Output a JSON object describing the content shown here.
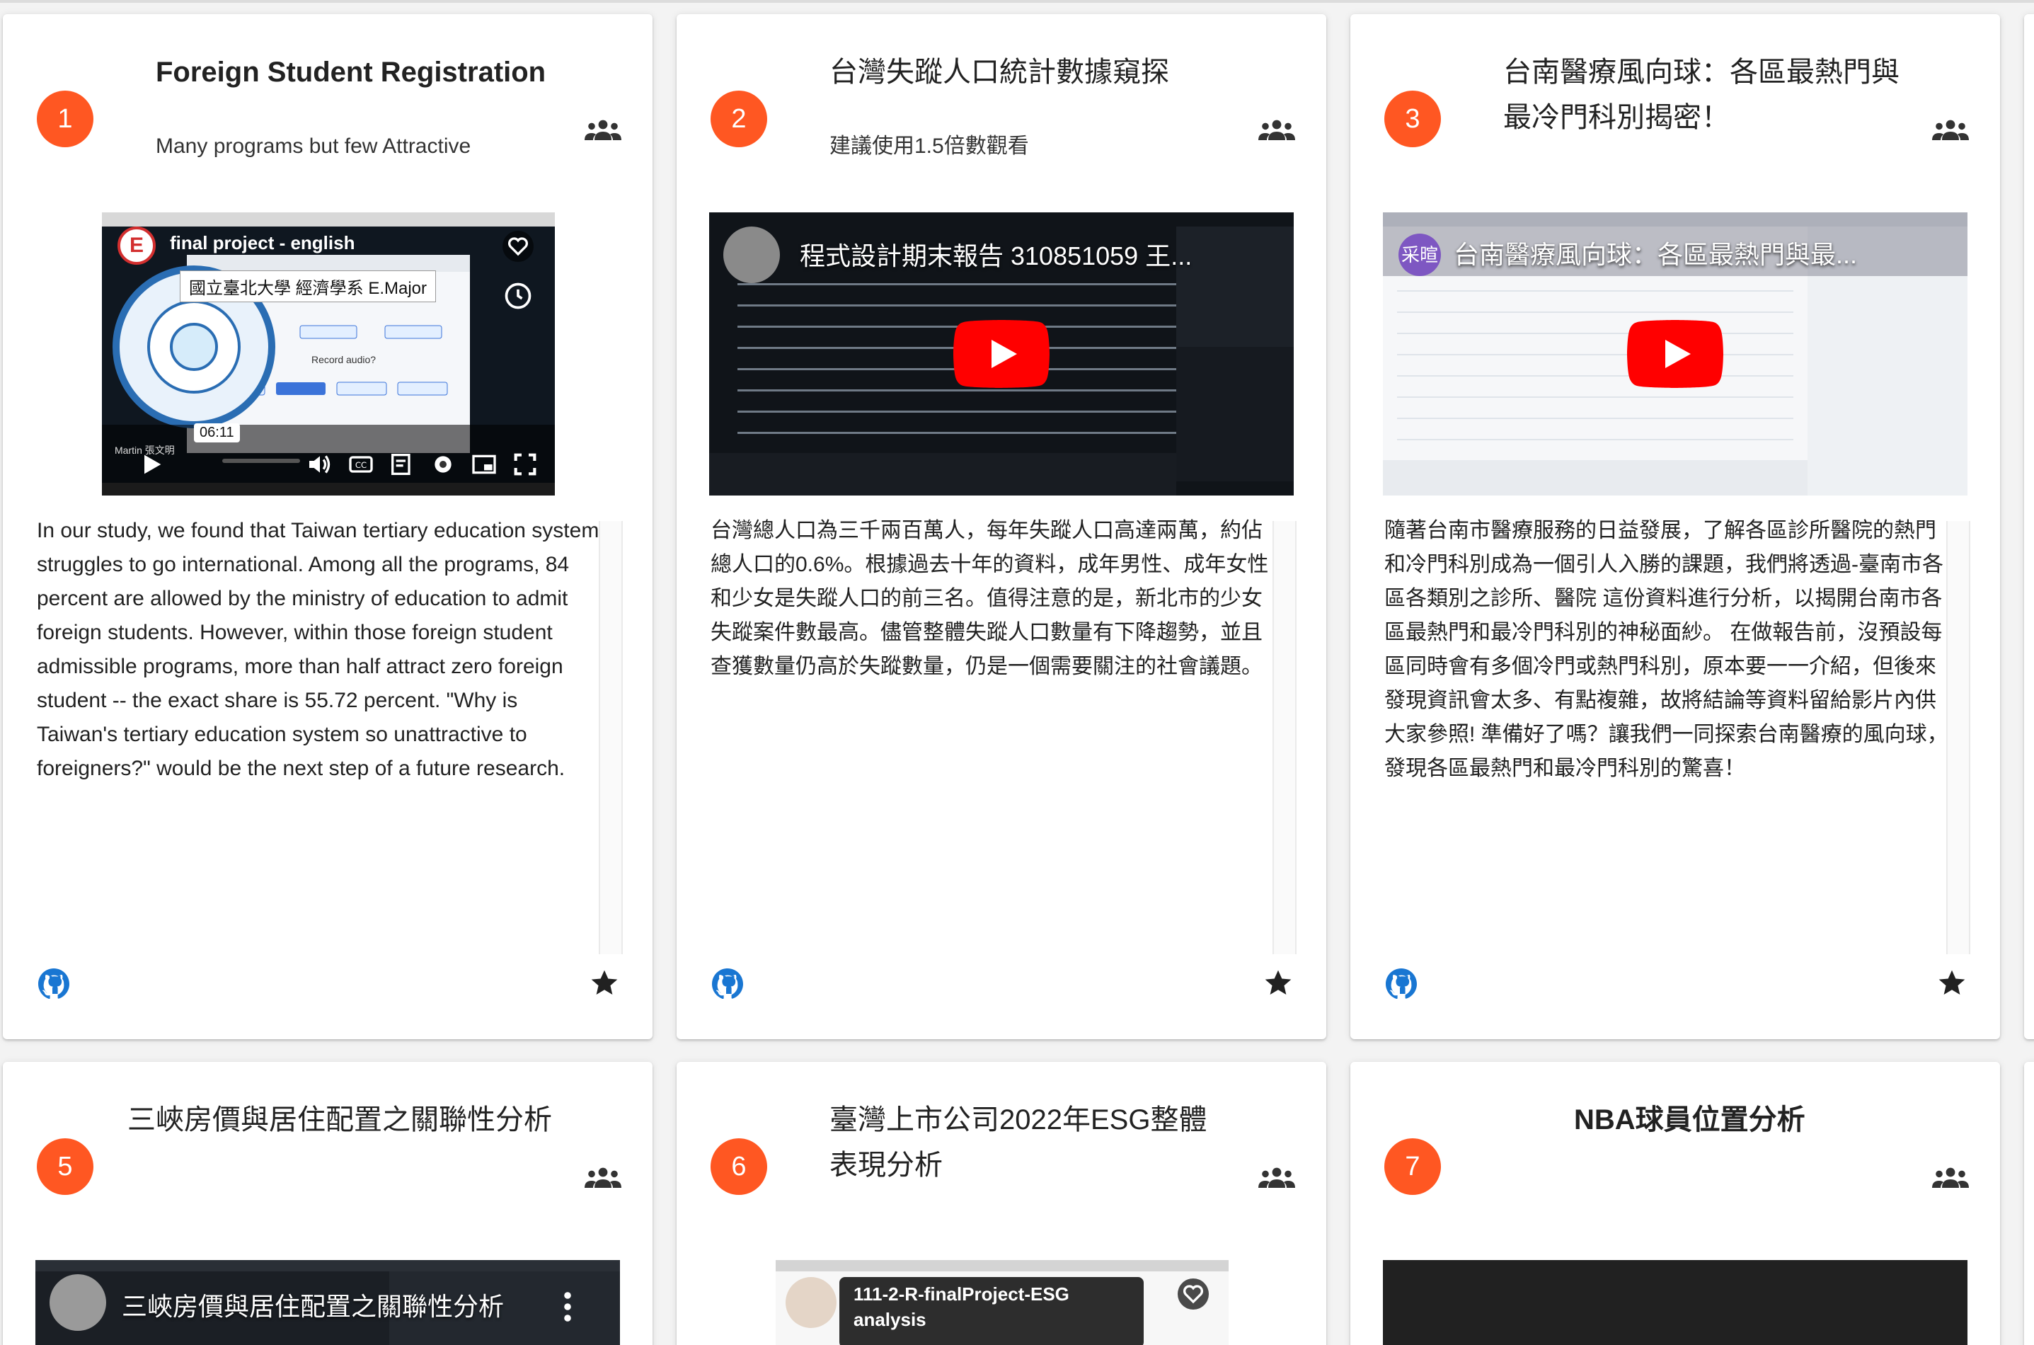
{
  "colors": {
    "accent": "#ff5722",
    "icon_blue": "#1976d2",
    "youtube_red": "#ff0000"
  },
  "cards": [
    {
      "number": "1",
      "title": "Foreign Student Registration",
      "subtitle": "Many programs but few Attractive",
      "thumbnail": {
        "channel_title": "final project - english",
        "subtitle": "國立臺北大學 經濟學系 E.Major",
        "time": "06:11",
        "dialog_button": "Record audio?",
        "footer": "Martin 張文明"
      },
      "description": "In our study, we found that Taiwan tertiary education system struggles to go international. Among all the programs, 84 percent are allowed by the ministry of education to admit foreign students. However, within those foreign student admissible programs, more than half attract zero foreign student -- the exact share is 55.72 percent. \"Why is Taiwan's tertiary education system so unattractive to foreigners?\" would be the next step of a future research."
    },
    {
      "number": "2",
      "title": "台灣失蹤人口統計數據窺探",
      "subtitle": "建議使用1.5倍數觀看",
      "thumbnail": {
        "video_title": "程式設計期末報告 310851059 王..."
      },
      "description": "台灣總人口為三千兩百萬人，每年失蹤人口高達兩萬，約佔總人口的0.6%。根據過去十年的資料，成年男性、成年女性和少女是失蹤人口的前三名。值得注意的是，新北市的少女失蹤案件數最高。儘管整體失蹤人口數量有下降趨勢，並且查獲數量仍高於失蹤數量，仍是一個需要關注的社會議題。"
    },
    {
      "number": "3",
      "title": "台南醫療風向球：各區最熱門與最冷門科別揭密！",
      "subtitle": "",
      "thumbnail": {
        "channel_avatar": "采暄",
        "video_title": "台南醫療風向球：各區最熱門與最..."
      },
      "description": "隨著台南市醫療服務的日益發展，了解各區診所醫院的熱門和冷門科別成為一個引人入勝的課題，我們將透過-臺南市各區各類別之診所、醫院 這份資料進行分析，以揭開台南市各區最熱門和最冷門科別的神秘面紗。 在做報告前，沒預設每區同時會有多個冷門或熱門科別，原本要一一介紹，但後來發現資訊會太多、有點複雜，故將結論等資料留給影片內供大家參照! 準備好了嗎？讓我們一同探索台南醫療的風向球，發現各區最熱門和最冷門科別的驚喜！"
    },
    {
      "number": "5",
      "title": "三峽房價與居住配置之關聯性分析",
      "thumbnail": {
        "video_title": "三峽房價與居住配置之關聯性分析"
      }
    },
    {
      "number": "6",
      "title": "臺灣上市公司2022年ESG整體表現分析",
      "thumbnail": {
        "video_title": "111-2-R-finalProject-ESG analysis"
      }
    },
    {
      "number": "7",
      "title": "NBA球員位置分析"
    }
  ]
}
